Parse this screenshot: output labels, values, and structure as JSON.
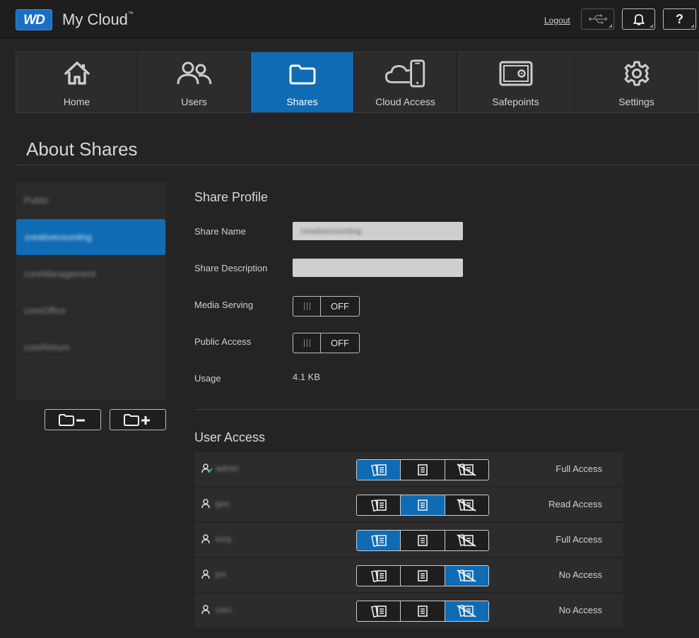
{
  "header": {
    "logo_text": "WD",
    "app_title": "My Cloud",
    "app_title_mark": "™",
    "logout_label": "Logout",
    "help_label": "?"
  },
  "nav": {
    "items": [
      {
        "label": "Home",
        "icon": "home-icon"
      },
      {
        "label": "Users",
        "icon": "users-icon"
      },
      {
        "label": "Shares",
        "icon": "folder-icon",
        "active": true
      },
      {
        "label": "Cloud Access",
        "icon": "cloud-phone-icon"
      },
      {
        "label": "Safepoints",
        "icon": "safe-icon"
      },
      {
        "label": "Settings",
        "icon": "gear-icon"
      }
    ]
  },
  "page": {
    "title": "About Shares"
  },
  "share_list": {
    "items": [
      {
        "label": "Public"
      },
      {
        "label": "creativecounting",
        "selected": true
      },
      {
        "label": "coreManagement"
      },
      {
        "label": "coreOffice"
      },
      {
        "label": "coreReturn"
      }
    ]
  },
  "profile": {
    "title": "Share Profile",
    "name_label": "Share Name",
    "name_value": "creativecounting",
    "description_label": "Share Description",
    "description_value": "",
    "media_label": "Media Serving",
    "media_state": "OFF",
    "public_label": "Public Access",
    "public_state": "OFF",
    "usage_label": "Usage",
    "usage_value": "4.1 KB"
  },
  "user_access": {
    "title": "User Access",
    "rows": [
      {
        "user": "admin",
        "admin": true,
        "level": "full",
        "label": "Full Access"
      },
      {
        "user": "gen",
        "admin": false,
        "level": "read",
        "label": "Read Access"
      },
      {
        "user": "tony",
        "admin": false,
        "level": "full",
        "label": "Full Access"
      },
      {
        "user": "jim",
        "admin": false,
        "level": "none",
        "label": "No Access"
      },
      {
        "user": "sam",
        "admin": false,
        "level": "none",
        "label": "No Access"
      }
    ]
  },
  "colors": {
    "accent": "#0f6bb3",
    "background": "#242424",
    "panel": "#2c2c2c",
    "admin_check": "#3ec46d"
  }
}
